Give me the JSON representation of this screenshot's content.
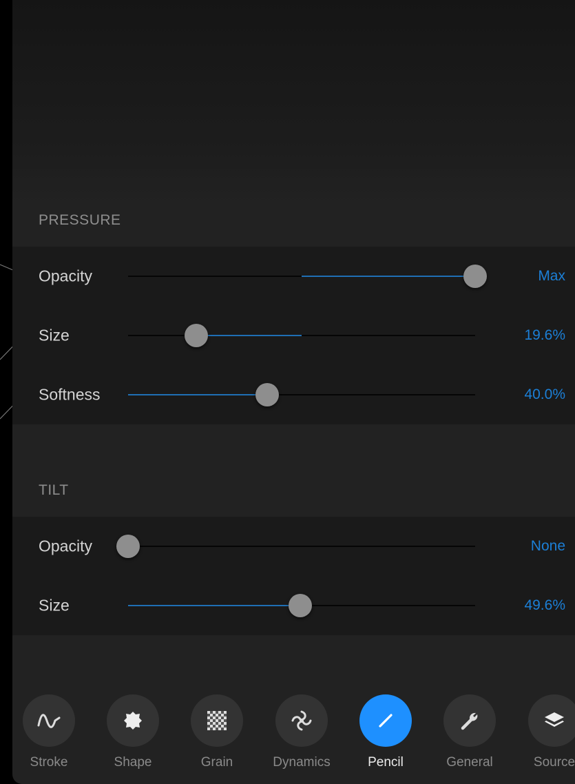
{
  "pressure": {
    "header": "PRESSURE",
    "rows": [
      {
        "label": "Opacity",
        "value": "Max",
        "level": 1.0,
        "fill_from": 0.5
      },
      {
        "label": "Size",
        "value": "19.6%",
        "level": 0.196,
        "fill_from": 0.5
      },
      {
        "label": "Softness",
        "value": "40.0%",
        "level": 0.4,
        "fill_from": 0.0
      }
    ]
  },
  "tilt": {
    "header": "TILT",
    "rows": [
      {
        "label": "Opacity",
        "value": "None",
        "level": 0.0
      },
      {
        "label": "Size",
        "value": "49.6%",
        "level": 0.496
      }
    ]
  },
  "tabs": [
    {
      "label": "Stroke",
      "icon": "stroke-wave-icon",
      "active": false
    },
    {
      "label": "Shape",
      "icon": "shape-blob-icon",
      "active": false
    },
    {
      "label": "Grain",
      "icon": "grain-checker-icon",
      "active": false
    },
    {
      "label": "Dynamics",
      "icon": "dynamics-swirl-icon",
      "active": false
    },
    {
      "label": "Pencil",
      "icon": "pencil-icon",
      "active": true
    },
    {
      "label": "General",
      "icon": "wrench-icon",
      "active": false
    },
    {
      "label": "Source",
      "icon": "layers-icon",
      "active": false
    }
  ],
  "colors": {
    "accent": "#1e90ff",
    "value_text": "#1c7fd6",
    "slider_fill": "#1f6fb5",
    "panel_bg": "#222222"
  }
}
